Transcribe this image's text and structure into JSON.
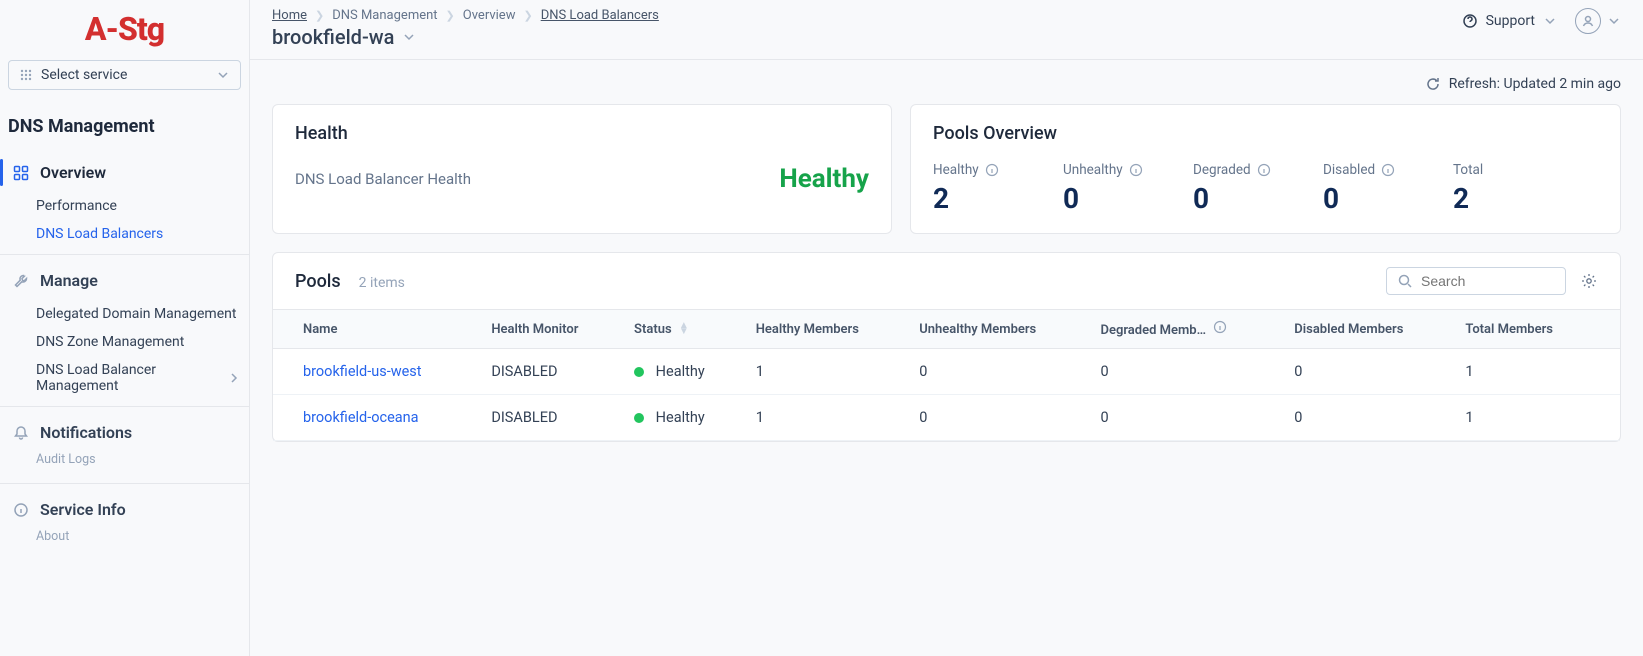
{
  "brand": {
    "logo_text": "A-Stg"
  },
  "sidebar": {
    "service_selector": {
      "label": "Select service"
    },
    "section_title": "DNS Management",
    "overview": {
      "label": "Overview",
      "items": [
        {
          "label": "Performance"
        },
        {
          "label": "DNS Load Balancers"
        }
      ]
    },
    "manage": {
      "label": "Manage",
      "items": [
        {
          "label": "Delegated Domain Management"
        },
        {
          "label": "DNS Zone Management"
        },
        {
          "label": "DNS Load Balancer Management"
        }
      ]
    },
    "notifications": {
      "label": "Notifications",
      "meta": "Audit Logs"
    },
    "service_info": {
      "label": "Service Info",
      "meta": "About"
    }
  },
  "header": {
    "breadcrumbs": [
      {
        "label": "Home"
      },
      {
        "label": "DNS Management"
      },
      {
        "label": "Overview"
      },
      {
        "label": "DNS Load Balancers"
      }
    ],
    "page_title": "brookfield-wa",
    "support_label": "Support"
  },
  "refresh": {
    "text": "Refresh: Updated 2 min ago"
  },
  "health_card": {
    "title": "Health",
    "label": "DNS Load Balancer Health",
    "status": "Healthy"
  },
  "pools_overview": {
    "title": "Pools Overview",
    "stats": [
      {
        "label": "Healthy",
        "value": "2",
        "info": true
      },
      {
        "label": "Unhealthy",
        "value": "0",
        "info": true
      },
      {
        "label": "Degraded",
        "value": "0",
        "info": true
      },
      {
        "label": "Disabled",
        "value": "0",
        "info": true
      },
      {
        "label": "Total",
        "value": "2",
        "info": false
      }
    ]
  },
  "pools_table": {
    "title": "Pools",
    "count_text": "2 items",
    "search_placeholder": "Search",
    "columns": {
      "name": "Name",
      "health_monitor": "Health Monitor",
      "status": "Status",
      "healthy_members": "Healthy Members",
      "unhealthy_members": "Unhealthy Members",
      "degraded_members": "Degraded Memb…",
      "disabled_members": "Disabled Members",
      "total_members": "Total Members"
    },
    "rows": [
      {
        "name": "brookfield-us-west",
        "health_monitor": "DISABLED",
        "status": "Healthy",
        "healthy": "1",
        "unhealthy": "0",
        "degraded": "0",
        "disabled": "0",
        "total": "1"
      },
      {
        "name": "brookfield-oceana",
        "health_monitor": "DISABLED",
        "status": "Healthy",
        "healthy": "1",
        "unhealthy": "0",
        "degraded": "0",
        "disabled": "0",
        "total": "1"
      }
    ]
  }
}
